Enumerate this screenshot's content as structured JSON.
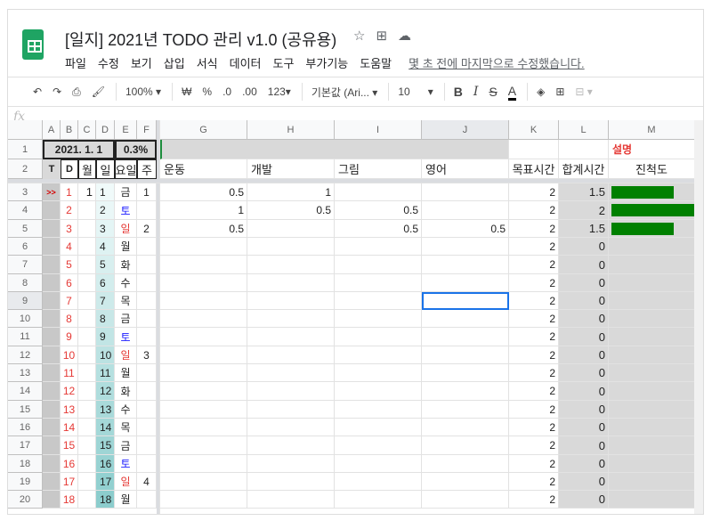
{
  "title": "[일지] 2021년 TODO 관리 v1.0 (공유용)",
  "title_icons": [
    "star-icon",
    "move-folder-icon",
    "cloud-status-icon"
  ],
  "menu": [
    "파일",
    "수정",
    "보기",
    "삽입",
    "서식",
    "데이터",
    "도구",
    "부가기능",
    "도움말"
  ],
  "last_edit": "몇 초 전에 마지막으로 수정했습니다.",
  "toolbar": {
    "zoom": "100%",
    "currency": "₩",
    "percent": "%",
    "dec_less": ".0",
    "dec_more": ".00",
    "format": "123",
    "font": "기본값 (Ari...",
    "size": "10"
  },
  "fx": "fx",
  "columns": [
    "A",
    "B",
    "C",
    "D",
    "E",
    "F",
    "G",
    "H",
    "I",
    "J",
    "K",
    "L",
    "M"
  ],
  "row1": {
    "date": "2021. 1. 1",
    "percent": "0.3%",
    "desc": "설명"
  },
  "row2": [
    "T",
    "D",
    "월",
    "일",
    "요일",
    "주",
    "운동",
    "개발",
    "그림",
    "영어",
    "목표시간",
    "합계시간",
    "진척도"
  ],
  "rows": [
    {
      "n": "3",
      "a": ">>",
      "b": "1",
      "c": "1",
      "d": "1",
      "e": "금",
      "f": "1",
      "g": "0.5",
      "h": "1",
      "i": "",
      "j": "",
      "k": "2",
      "l": "1.5",
      "p": 0.75
    },
    {
      "n": "4",
      "a": "",
      "b": "2",
      "c": "",
      "d": "2",
      "e": "토",
      "f": "",
      "g": "1",
      "h": "0.5",
      "i": "0.5",
      "j": "",
      "k": "2",
      "l": "2",
      "p": 1.0
    },
    {
      "n": "5",
      "a": "",
      "b": "3",
      "c": "",
      "d": "3",
      "e": "일",
      "f": "2",
      "g": "0.5",
      "h": "",
      "i": "0.5",
      "j": "0.5",
      "k": "2",
      "l": "1.5",
      "p": 0.75
    },
    {
      "n": "6",
      "a": "",
      "b": "4",
      "c": "",
      "d": "4",
      "e": "월",
      "f": "",
      "g": "",
      "h": "",
      "i": "",
      "j": "",
      "k": "2",
      "l": "0",
      "p": 0
    },
    {
      "n": "7",
      "a": "",
      "b": "5",
      "c": "",
      "d": "5",
      "e": "화",
      "f": "",
      "g": "",
      "h": "",
      "i": "",
      "j": "",
      "k": "2",
      "l": "0",
      "p": 0
    },
    {
      "n": "8",
      "a": "",
      "b": "6",
      "c": "",
      "d": "6",
      "e": "수",
      "f": "",
      "g": "",
      "h": "",
      "i": "",
      "j": "",
      "k": "2",
      "l": "0",
      "p": 0
    },
    {
      "n": "9",
      "a": "",
      "b": "7",
      "c": "",
      "d": "7",
      "e": "목",
      "f": "",
      "g": "",
      "h": "",
      "i": "",
      "j": "",
      "k": "2",
      "l": "0",
      "p": 0
    },
    {
      "n": "10",
      "a": "",
      "b": "8",
      "c": "",
      "d": "8",
      "e": "금",
      "f": "",
      "g": "",
      "h": "",
      "i": "",
      "j": "",
      "k": "2",
      "l": "0",
      "p": 0
    },
    {
      "n": "11",
      "a": "",
      "b": "9",
      "c": "",
      "d": "9",
      "e": "토",
      "f": "",
      "g": "",
      "h": "",
      "i": "",
      "j": "",
      "k": "2",
      "l": "0",
      "p": 0
    },
    {
      "n": "12",
      "a": "",
      "b": "10",
      "c": "",
      "d": "10",
      "e": "일",
      "f": "3",
      "g": "",
      "h": "",
      "i": "",
      "j": "",
      "k": "2",
      "l": "0",
      "p": 0
    },
    {
      "n": "13",
      "a": "",
      "b": "11",
      "c": "",
      "d": "11",
      "e": "월",
      "f": "",
      "g": "",
      "h": "",
      "i": "",
      "j": "",
      "k": "2",
      "l": "0",
      "p": 0
    },
    {
      "n": "14",
      "a": "",
      "b": "12",
      "c": "",
      "d": "12",
      "e": "화",
      "f": "",
      "g": "",
      "h": "",
      "i": "",
      "j": "",
      "k": "2",
      "l": "0",
      "p": 0
    },
    {
      "n": "15",
      "a": "",
      "b": "13",
      "c": "",
      "d": "13",
      "e": "수",
      "f": "",
      "g": "",
      "h": "",
      "i": "",
      "j": "",
      "k": "2",
      "l": "0",
      "p": 0
    },
    {
      "n": "16",
      "a": "",
      "b": "14",
      "c": "",
      "d": "14",
      "e": "목",
      "f": "",
      "g": "",
      "h": "",
      "i": "",
      "j": "",
      "k": "2",
      "l": "0",
      "p": 0
    },
    {
      "n": "17",
      "a": "",
      "b": "15",
      "c": "",
      "d": "15",
      "e": "금",
      "f": "",
      "g": "",
      "h": "",
      "i": "",
      "j": "",
      "k": "2",
      "l": "0",
      "p": 0
    },
    {
      "n": "18",
      "a": "",
      "b": "16",
      "c": "",
      "d": "16",
      "e": "토",
      "f": "",
      "g": "",
      "h": "",
      "i": "",
      "j": "",
      "k": "2",
      "l": "0",
      "p": 0
    },
    {
      "n": "19",
      "a": "",
      "b": "17",
      "c": "",
      "d": "17",
      "e": "일",
      "f": "4",
      "g": "",
      "h": "",
      "i": "",
      "j": "",
      "k": "2",
      "l": "0",
      "p": 0
    },
    {
      "n": "20",
      "a": "",
      "b": "18",
      "c": "",
      "d": "18",
      "e": "월",
      "f": "",
      "g": "",
      "h": "",
      "i": "",
      "j": "",
      "k": "2",
      "l": "0",
      "p": 0
    }
  ],
  "colors": {
    "red": "#e53935",
    "blue": "#1a1aff",
    "progress": "#008000",
    "shade": "#d9d9d9",
    "select": "#1a73e8"
  }
}
